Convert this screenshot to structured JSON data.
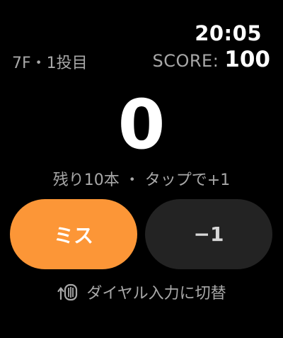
{
  "status_bar": {
    "time": "20:05"
  },
  "header": {
    "frame_label": "7F・1投目",
    "score_label": "SCORE:",
    "score_value": "100"
  },
  "main": {
    "count": "0",
    "hint": "残り10本 ・ タップで+1"
  },
  "buttons": {
    "miss_label": "ミス",
    "minus_label": "−1"
  },
  "footer": {
    "dial_icon": "digital-crown-rotate-icon",
    "dial_label": "ダイヤル入力に切替"
  },
  "colors": {
    "accent": "#fc9637",
    "secondary_button": "#232323",
    "muted_text": "#a8a8a8",
    "background": "#000000"
  }
}
